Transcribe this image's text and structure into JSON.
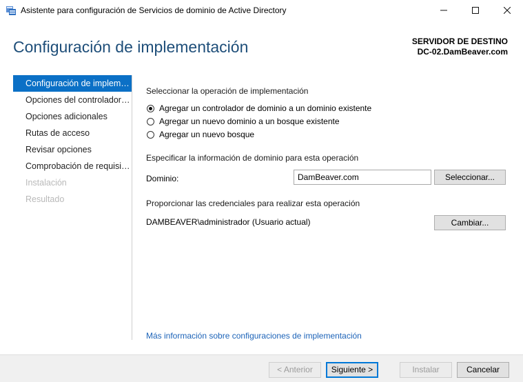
{
  "window": {
    "title": "Asistente para configuración de Servicios de dominio de Active Directory",
    "minimize_glyph": "—",
    "maximize_glyph": "☐",
    "close_glyph": "✕"
  },
  "page": {
    "heading": "Configuración de implementación",
    "destination_label": "SERVIDOR DE DESTINO",
    "destination_server": "DC-02.DamBeaver.com"
  },
  "nav": {
    "items": [
      {
        "label": "Configuración de implementación",
        "state": "active"
      },
      {
        "label": "Opciones del controlador de dominio",
        "state": "enabled"
      },
      {
        "label": "Opciones adicionales",
        "state": "enabled"
      },
      {
        "label": "Rutas de acceso",
        "state": "enabled"
      },
      {
        "label": "Revisar opciones",
        "state": "enabled"
      },
      {
        "label": "Comprobación de requisitos previos",
        "state": "enabled"
      },
      {
        "label": "Instalación",
        "state": "disabled"
      },
      {
        "label": "Resultado",
        "state": "disabled"
      }
    ]
  },
  "operation": {
    "label": "Seleccionar la operación de implementación",
    "options": [
      {
        "label": "Agregar un controlador de dominio a un dominio existente",
        "checked": true
      },
      {
        "label": "Agregar un nuevo dominio a un bosque existente",
        "checked": false
      },
      {
        "label": "Agregar un nuevo bosque",
        "checked": false
      }
    ]
  },
  "domain_info": {
    "label": "Especificar la información de dominio para esta operación",
    "domain_label": "Dominio:",
    "domain_value": "DamBeaver.com",
    "select_button": "Seleccionar..."
  },
  "credentials": {
    "label": "Proporcionar las credenciales para realizar esta operación",
    "current": "DAMBEAVER\\administrador (Usuario actual)",
    "change_button": "Cambiar..."
  },
  "more_info_link": "Más información sobre configuraciones de implementación",
  "footer": {
    "previous": "< Anterior",
    "next": "Siguiente >",
    "install": "Instalar",
    "cancel": "Cancelar"
  },
  "colors": {
    "accent": "#0b70c6",
    "heading": "#1e4e79",
    "link": "#1c63b8"
  }
}
